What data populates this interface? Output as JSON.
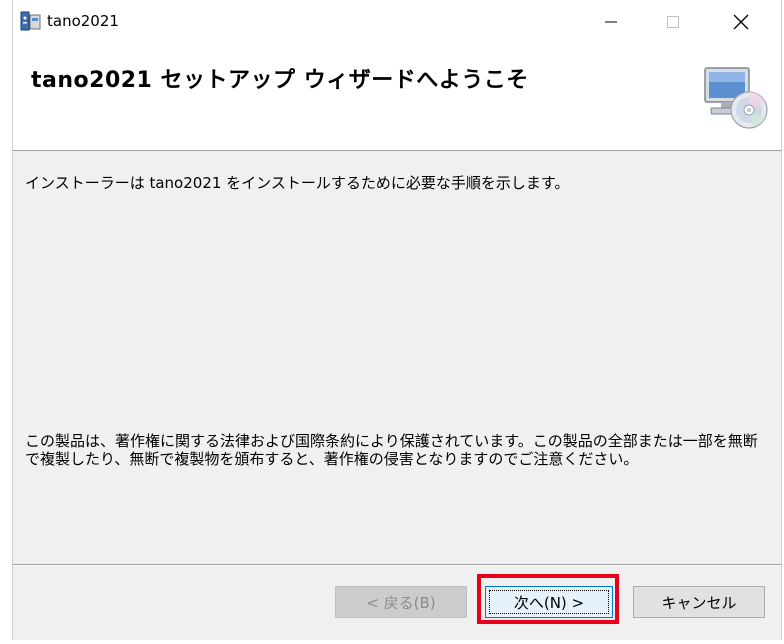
{
  "window": {
    "title": "tano2021"
  },
  "banner": {
    "title": "tano2021 セットアップ ウィザードへようこそ"
  },
  "body": {
    "intro": "インストーラーは tano2021 をインストールするために必要な手順を示します。",
    "copyright": "この製品は、著作権に関する法律および国際条約により保護されています。この製品の全部または一部を無断で複製したり、無断で複製物を頒布すると、著作権の侵害となりますのでご注意ください。"
  },
  "buttons": {
    "back_label": "< 戻る(B)",
    "next_label": "次へ(N) >",
    "cancel_label": "キャンセル"
  },
  "colors": {
    "highlight": "#e8001a",
    "focus_border": "#0078d7"
  }
}
